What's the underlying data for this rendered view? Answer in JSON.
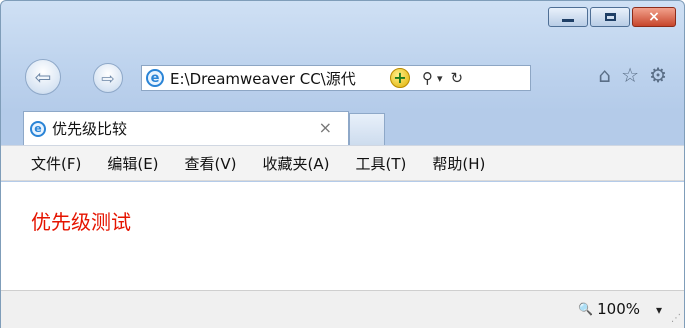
{
  "window_controls": {
    "minimize": "minimize",
    "maximize": "maximize",
    "close": "×"
  },
  "nav": {
    "back_glyph": "⇦",
    "forward_glyph": "⇨",
    "address": "E:\\Dreamweaver CC\\源代",
    "go_glyph": "+",
    "search_glyph": "⚲",
    "dropdown_glyph": "▾",
    "refresh_glyph": "↻",
    "home_glyph": "⌂",
    "favorites_glyph": "☆",
    "settings_glyph": "⚙"
  },
  "tab": {
    "title": "优先级比较",
    "close": "×"
  },
  "menu": {
    "items": [
      "文件(F)",
      "编辑(E)",
      "查看(V)",
      "收藏夹(A)",
      "工具(T)",
      "帮助(H)"
    ]
  },
  "content": {
    "text": "优先级测试",
    "text_color": "#e51400"
  },
  "status": {
    "zoom": "100%",
    "dropdown_glyph": "▾",
    "zoom_icon": "🔍"
  }
}
